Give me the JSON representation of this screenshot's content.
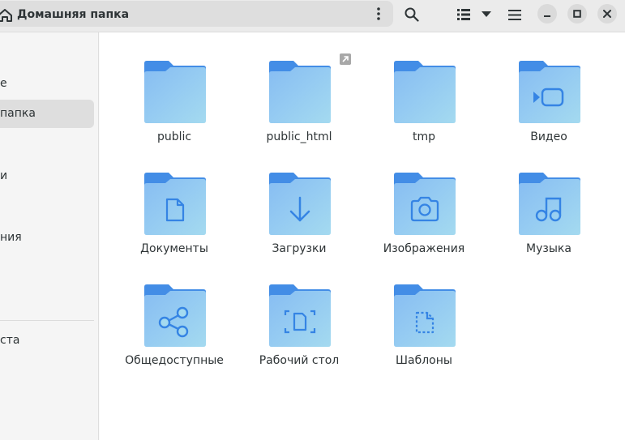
{
  "header": {
    "path_label": "Домашняя папка",
    "icons": [
      "home-icon",
      "more-vertical-icon",
      "search-icon",
      "list-view-icon",
      "chevron-down-icon",
      "hamburger-menu-icon",
      "minimize-icon",
      "maximize-icon",
      "close-icon"
    ]
  },
  "sidebar": {
    "items": [
      {
        "label": "е"
      },
      {
        "label": "папка"
      },
      {
        "label": "и"
      },
      {
        "label": "ния"
      },
      {
        "label": "ста"
      }
    ]
  },
  "folders": [
    {
      "label": "public",
      "icon": "folder-icon"
    },
    {
      "label": "public_html",
      "icon": "folder-icon",
      "emblem": "symlink-emblem-icon"
    },
    {
      "label": "tmp",
      "icon": "folder-icon"
    },
    {
      "label": "Видео",
      "icon": "folder-videos-icon"
    },
    {
      "label": "Документы",
      "icon": "folder-documents-icon"
    },
    {
      "label": "Загрузки",
      "icon": "folder-downloads-icon"
    },
    {
      "label": "Изображения",
      "icon": "folder-pictures-icon"
    },
    {
      "label": "Музыка",
      "icon": "folder-music-icon"
    },
    {
      "label": "Общедоступные",
      "icon": "folder-publicshare-icon"
    },
    {
      "label": "Рабочий стол",
      "icon": "folder-desktop-icon"
    },
    {
      "label": "Шаблоны",
      "icon": "folder-templates-icon"
    }
  ],
  "colors": {
    "folder_back": "#438de6",
    "folder_front_light": "#a4daf0",
    "folder_front_dark": "#87bdf3",
    "glyph": "#3584e4"
  }
}
